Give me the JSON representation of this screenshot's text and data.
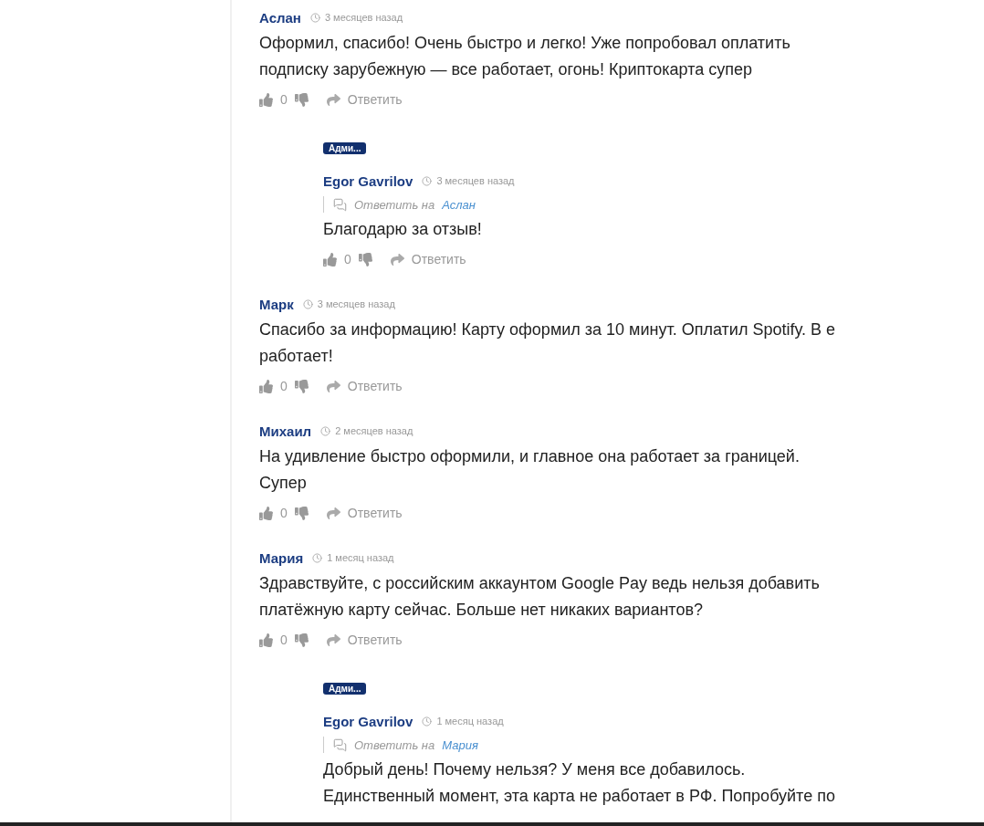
{
  "comments": [
    {
      "author": "Аслан",
      "time": "3 месяцев назад",
      "lines": [
        "Оформил, спасибо! Очень быстро и легко! Уже попробовал оплатить",
        "подписку зарубежную — все работает, огонь! Криптокарта супер"
      ],
      "likes": "0",
      "reply_label": "Ответить",
      "replies": [
        {
          "badge": "Адми...",
          "author": "Egor Gavrilov",
          "time": "3 месяцев назад",
          "reply_to_label": "Ответить на",
          "reply_to": "Аслан",
          "lines": [
            "Благодарю за отзыв!"
          ],
          "likes": "0",
          "reply_label": "Ответить"
        }
      ]
    },
    {
      "author": "Марк",
      "time": "3 месяцев назад",
      "lines": [
        "Спасибо за информацию! Карту оформил за 10 минут. Оплатил Spotify. В е",
        "работает!"
      ],
      "likes": "0",
      "reply_label": "Ответить"
    },
    {
      "author": "Михаил",
      "time": "2 месяцев назад",
      "lines": [
        "На удивление быстро оформили, и главное она работает за границей.",
        "Супер"
      ],
      "likes": "0",
      "reply_label": "Ответить"
    },
    {
      "author": "Мария",
      "time": "1 месяц назад",
      "lines": [
        "Здравствуйте, с российским аккаунтом Google Pay ведь нельзя добавить",
        "платёжную карту сейчас. Больше нет никаких вариантов?"
      ],
      "likes": "0",
      "reply_label": "Ответить",
      "replies": [
        {
          "badge": "Адми...",
          "author": "Egor Gavrilov",
          "time": "1 месяц назад",
          "reply_to_label": "Ответить на",
          "reply_to": "Мария",
          "lines": [
            "Добрый день! Почему нельзя? У меня все добавилось.",
            "Единственный момент, эта карта не работает в РФ. Попробуйте по"
          ]
        }
      ]
    }
  ]
}
